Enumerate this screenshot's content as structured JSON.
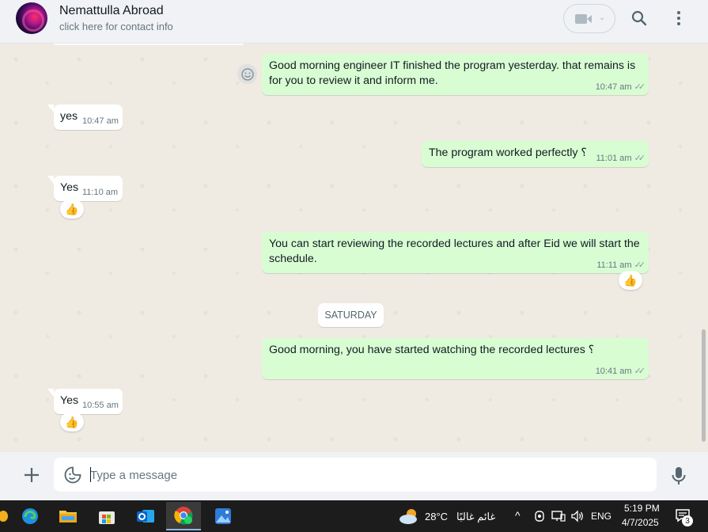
{
  "header": {
    "contact_name": "Nemattulla Abroad",
    "contact_subtitle": "click here for contact info"
  },
  "messages": [
    {
      "direction": "out",
      "lines": [
        "Good morning engineer IT  finished the program yesterday. that remains is",
        "for you to review it and inform me."
      ],
      "time": "10:47 am",
      "status": "read"
    },
    {
      "direction": "in",
      "text": "yes",
      "time": "10:47 am"
    },
    {
      "direction": "out",
      "text": "The program worked perfectly ؟",
      "time": "11:01 am",
      "status": "read"
    },
    {
      "direction": "in",
      "text": "Yes",
      "time": "11:10 am",
      "reaction": "👍"
    },
    {
      "direction": "out",
      "lines": [
        "You can start reviewing the recorded lectures and after Eid we will start the",
        "schedule."
      ],
      "time": "11:11 am",
      "status": "read",
      "reaction": "👍"
    },
    {
      "direction": "out",
      "text": "Good morning, you have started watching the recorded lectures ؟",
      "time": "10:41 am",
      "status": "read"
    },
    {
      "direction": "in",
      "text": "Yes",
      "time": "10:55 am",
      "reaction": "👍"
    }
  ],
  "date_divider": "SATURDAY",
  "composer": {
    "placeholder": "Type a message"
  },
  "taskbar": {
    "weather_temp": "28°C",
    "weather_desc": "غائم غالبًا",
    "language": "ENG",
    "time": "5:19 PM",
    "date": "4/7/2025",
    "notification_count": "3"
  },
  "colors": {
    "outgoing_bubble": "#d9fdd3",
    "incoming_bubble": "#ffffff",
    "chat_background": "#efeae2",
    "header_background": "#f0f2f5",
    "taskbar_background": "#1c1c1c"
  },
  "icons": [
    "video-call-icon",
    "search-icon",
    "menu-dots-icon",
    "emoji-icon",
    "plus-icon",
    "sticker-icon",
    "microphone-icon",
    "read-ticks-icon",
    "thumbs-up-icon"
  ]
}
